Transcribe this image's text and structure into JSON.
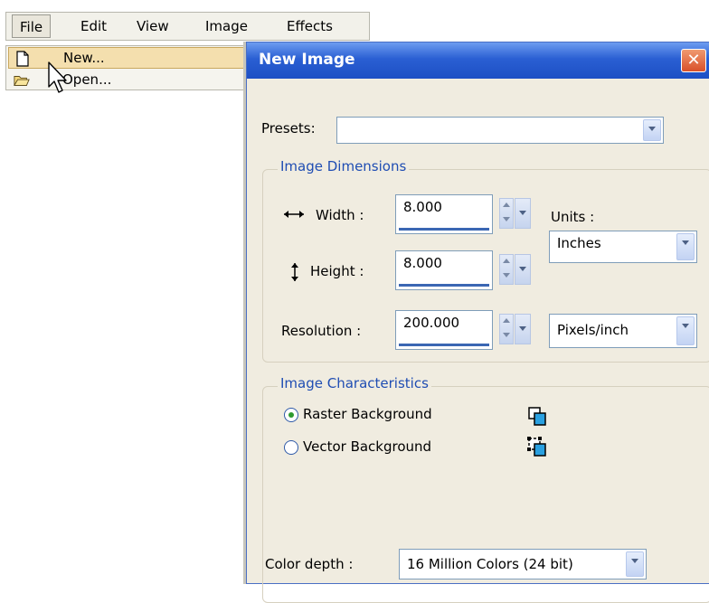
{
  "menubar": {
    "items": [
      "File",
      "Edit",
      "View",
      "Image",
      "Effects"
    ]
  },
  "file_menu": {
    "items": [
      {
        "label": "New...",
        "icon": "new-document-icon"
      },
      {
        "label": "Open...",
        "icon": "open-folder-icon"
      }
    ]
  },
  "dialog": {
    "title": "New Image",
    "close_glyph": "✕",
    "presets_label": "Presets:",
    "presets_value": "",
    "dimensions": {
      "group_title": "Image Dimensions",
      "width_label": "Width :",
      "width_value": "8.000",
      "height_label": "Height :",
      "height_value": "8.000",
      "resolution_label": "Resolution :",
      "resolution_value": "200.000",
      "units_label": "Units :",
      "units_value": "Inches",
      "resolution_units_value": "Pixels/inch"
    },
    "characteristics": {
      "group_title": "Image Characteristics",
      "raster_label": "Raster Background",
      "raster_checked": true,
      "vector_label": "Vector Background",
      "vector_checked": false
    },
    "color_depth_label": "Color depth :",
    "color_depth_value": "16 Million Colors (24 bit)"
  },
  "colors": {
    "title_bar": "#2a5fd3",
    "group_title": "#1f4db3",
    "menu_highlight": "#f4dfae",
    "field_bar": "#3b67b3",
    "close_button": "#d9502a"
  }
}
